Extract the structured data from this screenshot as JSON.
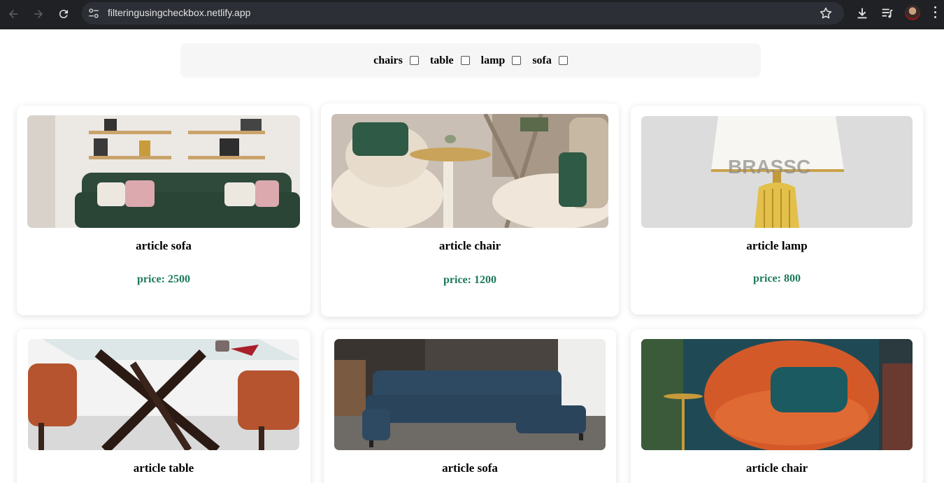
{
  "browser": {
    "url": "filteringusingcheckbox.netlify.app",
    "icons": [
      "back-arrow-icon",
      "forward-arrow-icon",
      "reload-icon",
      "site-info-icon",
      "bookmark-star-icon",
      "download-icon",
      "media-control-icon",
      "profile-avatar",
      "more-menu-icon"
    ]
  },
  "filters": [
    {
      "label": "chairs",
      "checked": false
    },
    {
      "label": "table",
      "checked": false
    },
    {
      "label": "lamp",
      "checked": false
    },
    {
      "label": "sofa",
      "checked": false
    }
  ],
  "products": [
    {
      "title": "article sofa",
      "price": "price: 2500"
    },
    {
      "title": "article chair",
      "price": "price: 1200"
    },
    {
      "title": "article lamp",
      "price": "price: 800"
    },
    {
      "title": "article table"
    },
    {
      "title": "article sofa"
    },
    {
      "title": "article chair"
    }
  ],
  "colors": {
    "price": "#1d7a5c",
    "chrome": "#202124",
    "filter_bar": "#f6f6f6"
  }
}
